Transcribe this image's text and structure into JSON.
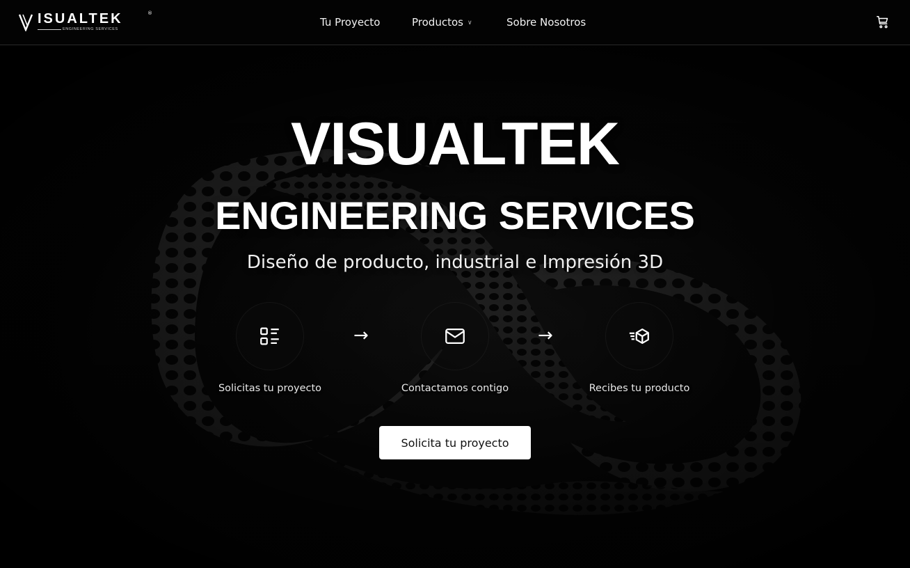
{
  "header": {
    "logo": {
      "wordmark": "ISUALTEK",
      "registered": "®",
      "subtitle": "Engineering Services"
    },
    "nav": [
      {
        "label": "Tu Proyecto"
      },
      {
        "label": "Productos",
        "has_dropdown": true
      },
      {
        "label": "Sobre Nosotros"
      }
    ],
    "cart_icon": "cart-icon"
  },
  "hero": {
    "title": "VISUALTEK",
    "subtitle": "ENGINEERING SERVICES",
    "tagline": "Diseño de producto, industrial e Impresión 3D",
    "steps": [
      {
        "icon": "list-icon",
        "label": "Solicitas tu proyecto"
      },
      {
        "icon": "mail-icon",
        "label": "Contactamos contigo"
      },
      {
        "icon": "fast-delivery-box-icon",
        "label": "Recibes tu producto"
      }
    ],
    "arrow_glyph": "→",
    "cta_label": "Solicita tu proyecto"
  },
  "colors": {
    "background": "#000000",
    "text": "#ffffff",
    "cta_background": "#ffffff",
    "cta_text": "#111111"
  }
}
